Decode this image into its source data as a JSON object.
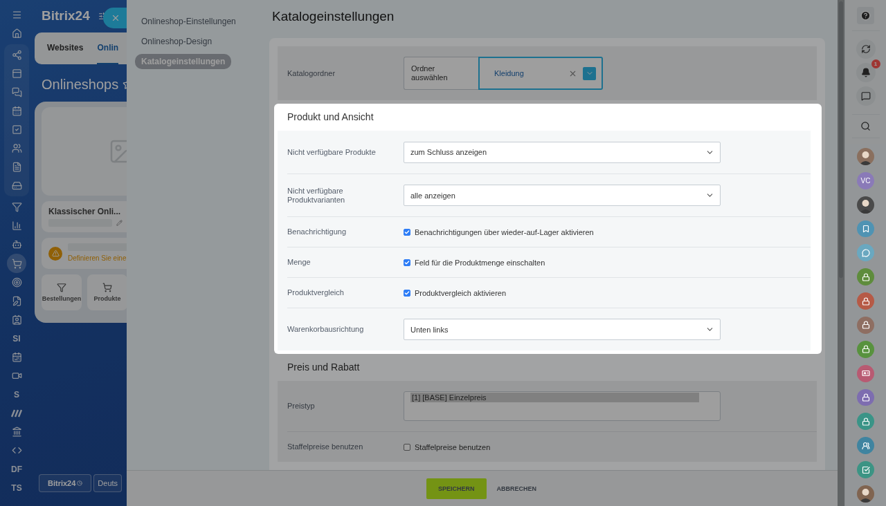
{
  "nav": {
    "sections": [
      {
        "framed": false,
        "items": [
          {
            "kind": "icon",
            "selected": false
          },
          {
            "kind": "icon",
            "selected": false
          }
        ]
      },
      {
        "framed": true,
        "items": [
          {
            "kind": "icon",
            "selected": false
          },
          {
            "kind": "icon",
            "selected": false
          },
          {
            "kind": "icon",
            "selected": false
          },
          {
            "kind": "icon",
            "selected": false
          },
          {
            "kind": "icon",
            "selected": false
          },
          {
            "kind": "icon",
            "selected": false
          },
          {
            "kind": "icon",
            "selected": false
          },
          {
            "kind": "icon",
            "selected": false
          }
        ]
      },
      {
        "framed": false,
        "items": [
          {
            "kind": "icon",
            "selected": false
          },
          {
            "kind": "icon",
            "selected": false
          },
          {
            "kind": "icon",
            "selected": false
          },
          {
            "kind": "icon",
            "selected": true
          },
          {
            "kind": "icon",
            "selected": false
          },
          {
            "kind": "icon",
            "selected": false
          },
          {
            "kind": "icon",
            "selected": false
          },
          {
            "kind": "text",
            "label": "SI",
            "selected": false
          },
          {
            "kind": "icon",
            "selected": false
          },
          {
            "kind": "icon",
            "selected": false
          },
          {
            "kind": "text",
            "label": "S",
            "selected": false
          },
          {
            "kind": "icon",
            "selected": false
          },
          {
            "kind": "icon",
            "selected": false
          },
          {
            "kind": "icon",
            "selected": false
          },
          {
            "kind": "text",
            "label": "DF",
            "selected": false
          },
          {
            "kind": "text",
            "label": "TS",
            "selected": false
          }
        ]
      }
    ]
  },
  "background_page": {
    "logo": "Bitrix24",
    "tabs": [
      {
        "label": "Websites",
        "selected": false
      },
      {
        "label": "Onlin",
        "selected": true
      }
    ],
    "title": "Onlineshops",
    "shop_card": {
      "name": "Klassischer Onli...",
      "warning": "Definieren Sie eine",
      "tiles": [
        {
          "label": "Bestellungen",
          "kind": "orders"
        },
        {
          "label": "Produkte",
          "kind": "products"
        }
      ]
    },
    "footer": {
      "logo_button": "Bitrix24",
      "language_button": "Deuts"
    }
  },
  "panel": {
    "menu": [
      {
        "label": "Onlineshop-Einstellungen",
        "selected": false
      },
      {
        "label": "Onlineshop-Design",
        "selected": false
      },
      {
        "label": "Katalogeinstellungen",
        "selected": true
      }
    ],
    "title": "Katalogeinstellungen",
    "catalog_folder": {
      "label": "Katalogordner",
      "prompt": "Ordner auswählen",
      "value": "Kleidung"
    },
    "sections": [
      {
        "title": "Produkt und Ansicht",
        "highlighted": true,
        "rows": [
          {
            "kind": "select",
            "label": "Nicht verfügbare Produkte",
            "value": "zum Schluss anzeigen"
          },
          {
            "kind": "select",
            "label": "Nicht verfügbare Produktvarianten",
            "value": "alle anzeigen"
          },
          {
            "kind": "checkbox",
            "label": "Benachrichtigung",
            "text": "Benachrichtigungen über wieder-auf-Lager aktivieren",
            "checked": true
          },
          {
            "kind": "checkbox",
            "label": "Menge",
            "text": "Feld für die Produktmenge einschalten",
            "checked": true
          },
          {
            "kind": "checkbox",
            "label": "Produktvergleich",
            "text": "Produktvergleich aktivieren",
            "checked": true
          },
          {
            "kind": "select",
            "label": "Warenkorbausrichtung",
            "value": "Unten links"
          }
        ]
      },
      {
        "title": "Preis und Rabatt",
        "highlighted": false,
        "rows": [
          {
            "kind": "listbox",
            "label": "Preistyp",
            "options": [
              {
                "label": "[1] [BASE] Einzelpreis",
                "selected": true
              }
            ]
          },
          {
            "kind": "checkbox",
            "label": "Staffelpreise benutzen",
            "text": "Staffelpreise benutzen",
            "checked": false
          }
        ]
      }
    ],
    "buttons": [
      {
        "label": "SPEICHERN",
        "kind": "primary"
      },
      {
        "label": "ABBRECHEN",
        "kind": "link"
      }
    ]
  },
  "right_bar": {
    "notification_count": "1",
    "items": [
      {
        "kind": "photo",
        "color": "#8a6f5e"
      },
      {
        "kind": "initials",
        "label": "VC",
        "color": "#8a7ab8"
      },
      {
        "kind": "photo",
        "color": "#4a4a4a"
      },
      {
        "kind": "bookmark",
        "color": "#4f93b3"
      },
      {
        "kind": "chat",
        "color": "#6aa8c0"
      },
      {
        "kind": "lock",
        "color": "#5e8c3c"
      },
      {
        "kind": "lock",
        "color": "#b65a46"
      },
      {
        "kind": "lock",
        "color": "#8e6e62"
      },
      {
        "kind": "lock",
        "color": "#58923e"
      },
      {
        "kind": "card",
        "color": "#b85a72"
      },
      {
        "kind": "lock",
        "color": "#7d6db0"
      },
      {
        "kind": "lock",
        "color": "#3a9487"
      },
      {
        "kind": "people",
        "color": "#3f84a0"
      },
      {
        "kind": "task",
        "color": "#3c9484"
      },
      {
        "kind": "photo",
        "color": "#806450"
      }
    ]
  }
}
